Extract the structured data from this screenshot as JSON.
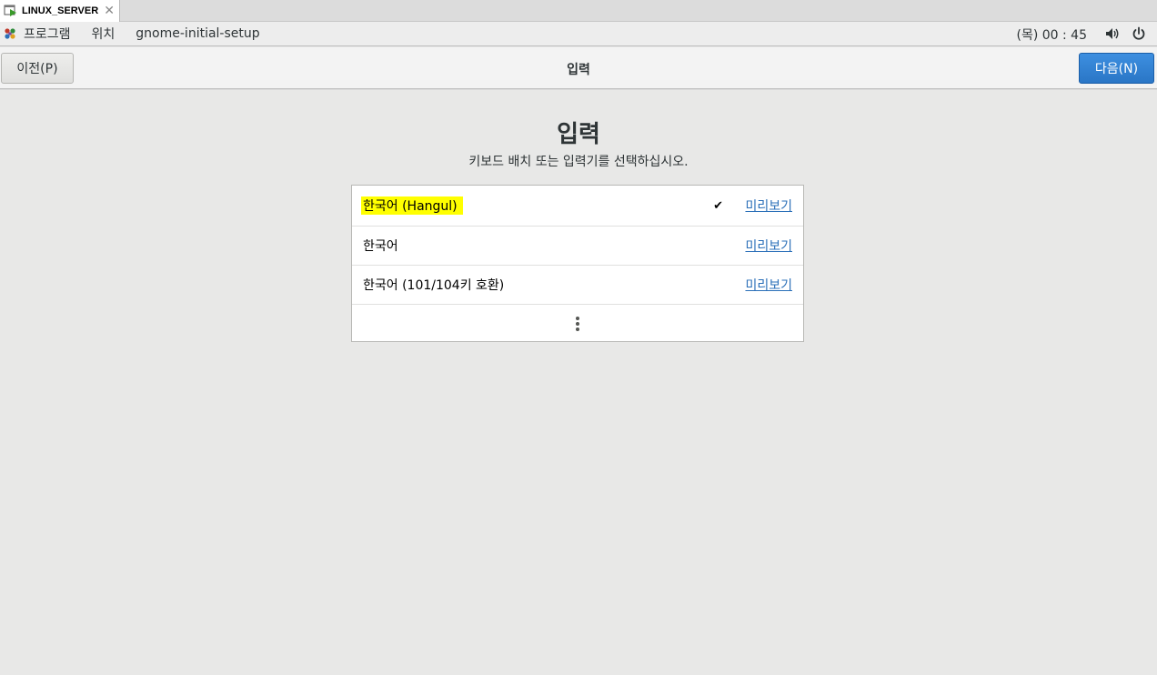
{
  "vm_tab": {
    "title": "LINUX_SERVER",
    "close_glyph": "✕"
  },
  "topbar": {
    "apps_label": "프로그램",
    "places_label": "위치",
    "active_app": "gnome-initial-setup",
    "clock": "(목) 00 : 45",
    "icons": [
      "volume-icon",
      "power-icon"
    ]
  },
  "header": {
    "prev_label": "이전(P)",
    "title": "입력",
    "next_label": "다음(N)",
    "accent_color": "#2a76c6"
  },
  "page": {
    "heading": "입력",
    "description": "키보드 배치 또는 입력기를 선택하십시오."
  },
  "input_sources": [
    {
      "name": "한국어 (Hangul)",
      "selected": true,
      "check": "✔",
      "preview": "미리보기"
    },
    {
      "name": "한국어",
      "selected": false,
      "preview": "미리보기"
    },
    {
      "name": "한국어 (101/104키 호환)",
      "selected": false,
      "preview": "미리보기"
    }
  ]
}
